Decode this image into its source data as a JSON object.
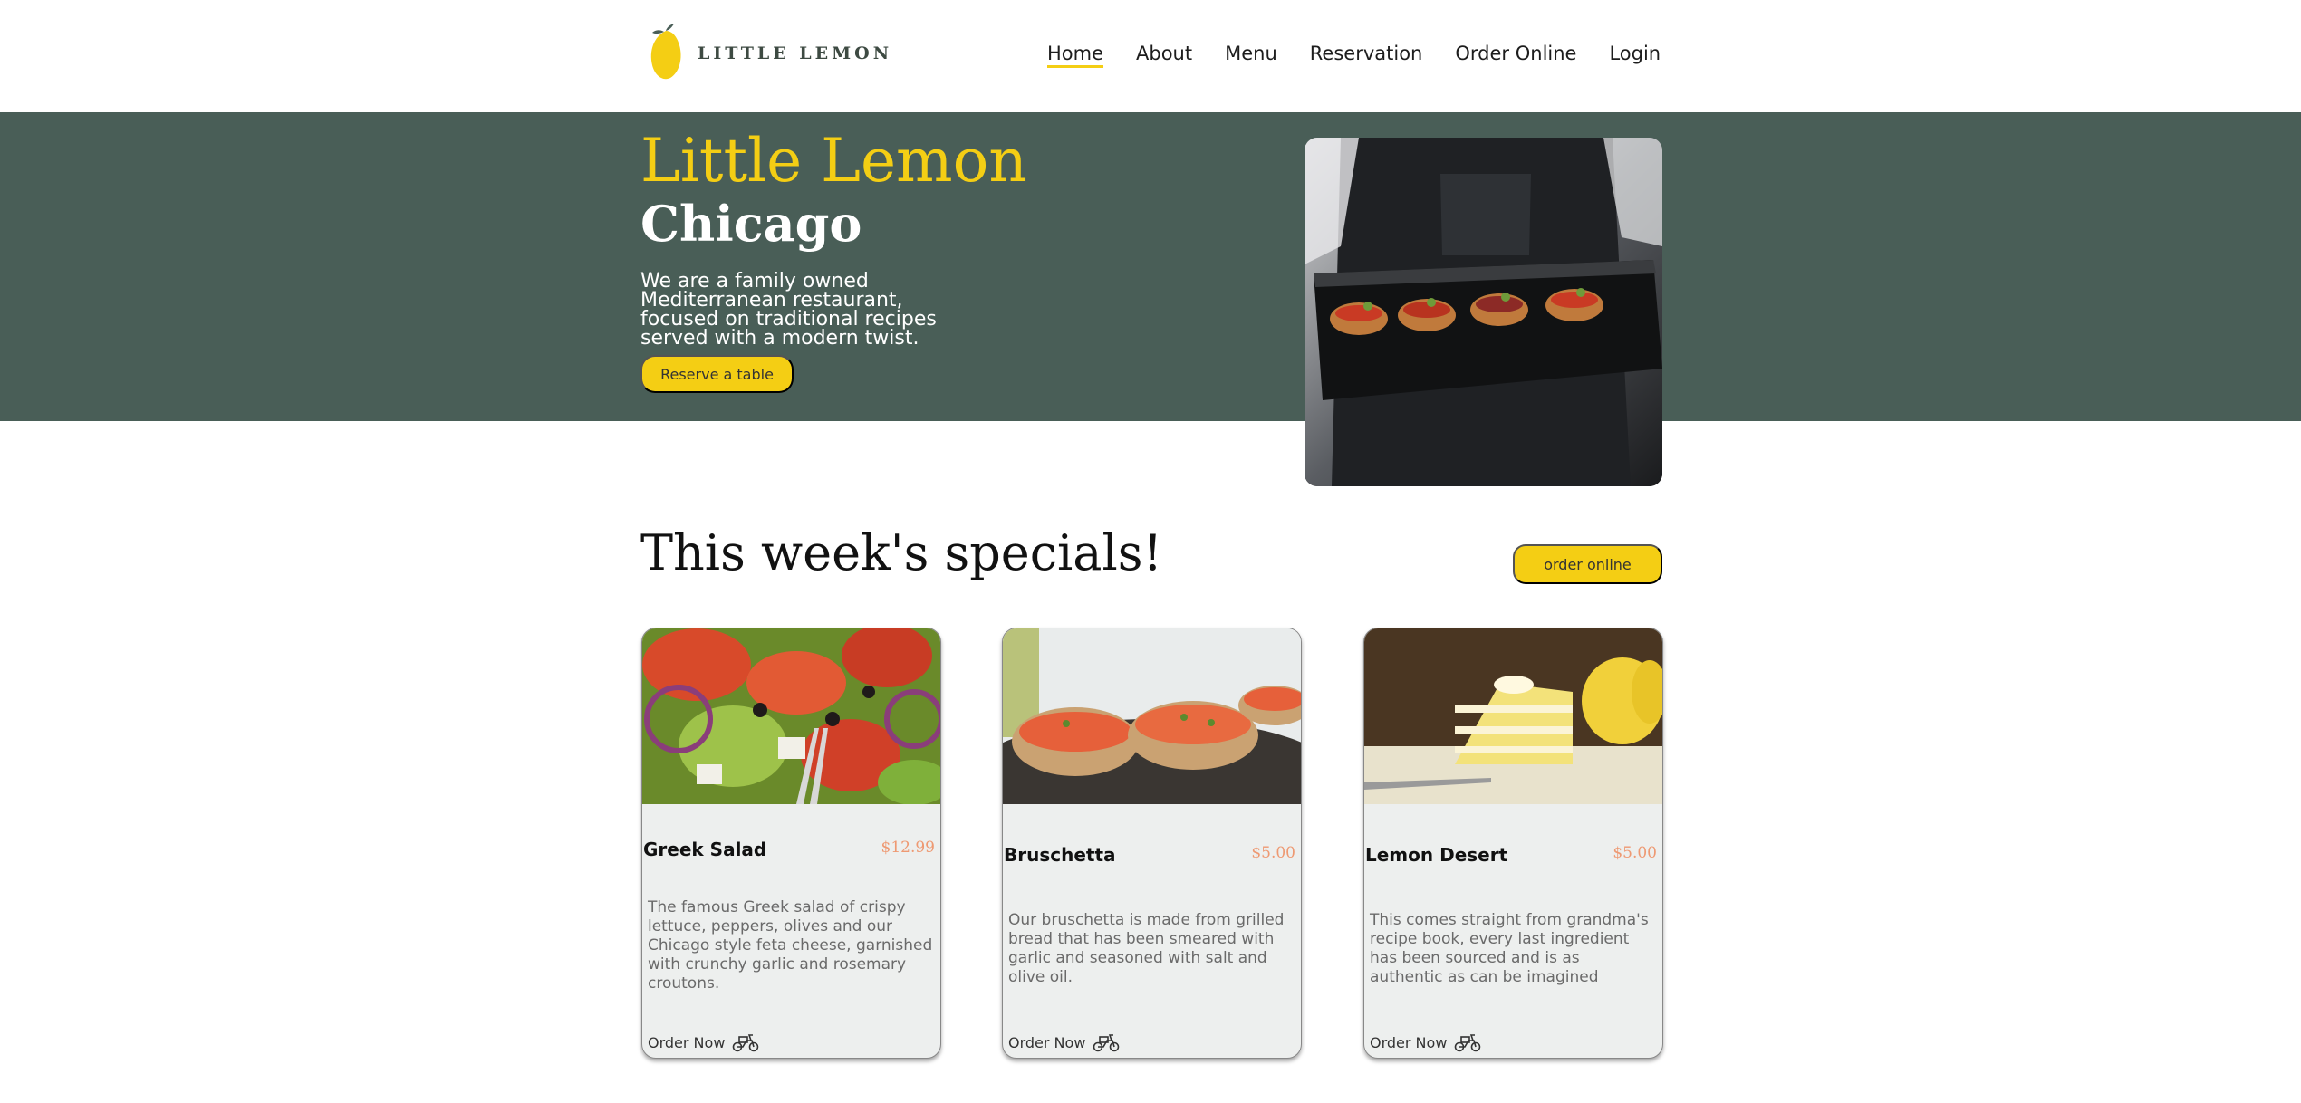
{
  "header": {
    "logo_text": "LITTLE LEMON",
    "nav": [
      {
        "label": "Home",
        "active": true
      },
      {
        "label": "About"
      },
      {
        "label": "Menu"
      },
      {
        "label": "Reservation"
      },
      {
        "label": "Order Online"
      },
      {
        "label": "Login"
      }
    ]
  },
  "hero": {
    "title": "Little Lemon",
    "subtitle": "Chicago",
    "description": "We are a family owned Mediterranean restaurant, focused on traditional recipes served with a modern twist.",
    "reserve_label": "Reserve a table"
  },
  "specials": {
    "title": "This week's specials!",
    "order_online_label": "order online",
    "cards": [
      {
        "name": "Greek Salad",
        "price": "$12.99",
        "description": "The famous Greek salad of crispy lettuce, peppers, olives and our Chicago style feta cheese, garnished with crunchy garlic and rosemary croutons.",
        "order_label": "Order Now"
      },
      {
        "name": "Bruschetta",
        "price": "$5.00",
        "description": "Our bruschetta is made from grilled bread that has been smeared with garlic and seasoned with salt and olive oil.",
        "order_label": "Order Now"
      },
      {
        "name": "Lemon Desert",
        "price": "$5.00",
        "description": "This comes straight from grandma's recipe book, every last ingredient has been sourced and is as authentic as can be imagined",
        "order_label": "Order Now"
      }
    ]
  },
  "colors": {
    "primary_green": "#495e57",
    "primary_yellow": "#f4ce14",
    "price_salmon": "#ee9972",
    "card_bg": "#edefee"
  }
}
